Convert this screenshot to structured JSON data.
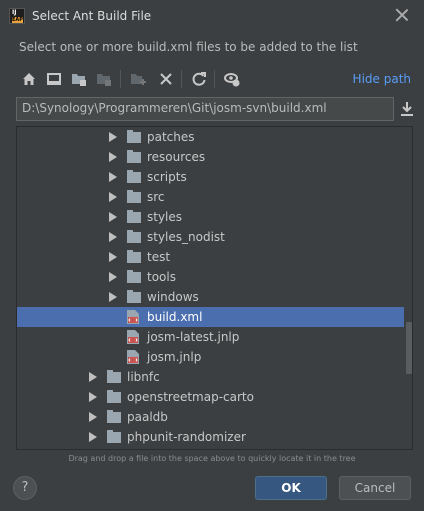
{
  "window": {
    "title": "Select Ant Build File",
    "app_icon_text": "IJ",
    "app_icon_badge": "EAP"
  },
  "description": "Select one or more build.xml files to be added to the list",
  "toolbar": {
    "hide_path_label": "Hide path",
    "icons": [
      "home-icon",
      "desktop-icon",
      "project-folder-icon",
      "module-folder-icon",
      "new-folder-icon",
      "delete-icon",
      "refresh-icon",
      "show-hidden-icon"
    ]
  },
  "path": {
    "value": "D:\\Synology\\Programmeren\\Git\\josm-svn\\build.xml"
  },
  "tree": {
    "rows": [
      {
        "label": "patches",
        "type": "folder",
        "depth": 1,
        "selected": false
      },
      {
        "label": "resources",
        "type": "folder",
        "depth": 1,
        "selected": false
      },
      {
        "label": "scripts",
        "type": "folder",
        "depth": 1,
        "selected": false
      },
      {
        "label": "src",
        "type": "folder",
        "depth": 1,
        "selected": false
      },
      {
        "label": "styles",
        "type": "folder",
        "depth": 1,
        "selected": false
      },
      {
        "label": "styles_nodist",
        "type": "folder",
        "depth": 1,
        "selected": false
      },
      {
        "label": "test",
        "type": "folder",
        "depth": 1,
        "selected": false
      },
      {
        "label": "tools",
        "type": "folder",
        "depth": 1,
        "selected": false
      },
      {
        "label": "windows",
        "type": "folder",
        "depth": 1,
        "selected": false
      },
      {
        "label": "build.xml",
        "type": "file",
        "depth": 1,
        "selected": true
      },
      {
        "label": "josm-latest.jnlp",
        "type": "file",
        "depth": 1,
        "selected": false
      },
      {
        "label": "josm.jnlp",
        "type": "file",
        "depth": 1,
        "selected": false
      },
      {
        "label": "libnfc",
        "type": "folder",
        "depth": 0,
        "selected": false
      },
      {
        "label": "openstreetmap-carto",
        "type": "folder",
        "depth": 0,
        "selected": false
      },
      {
        "label": "paaldb",
        "type": "folder",
        "depth": 0,
        "selected": false
      },
      {
        "label": "phpunit-randomizer",
        "type": "folder",
        "depth": 0,
        "selected": false
      }
    ]
  },
  "hint": "Drag and drop a file into the space above to quickly locate it in the tree",
  "buttons": {
    "help": "?",
    "ok": "OK",
    "cancel": "Cancel"
  },
  "colors": {
    "background": "#3c3f41",
    "selection": "#4b6eaf",
    "link": "#589df6",
    "ok_button": "#365880"
  }
}
